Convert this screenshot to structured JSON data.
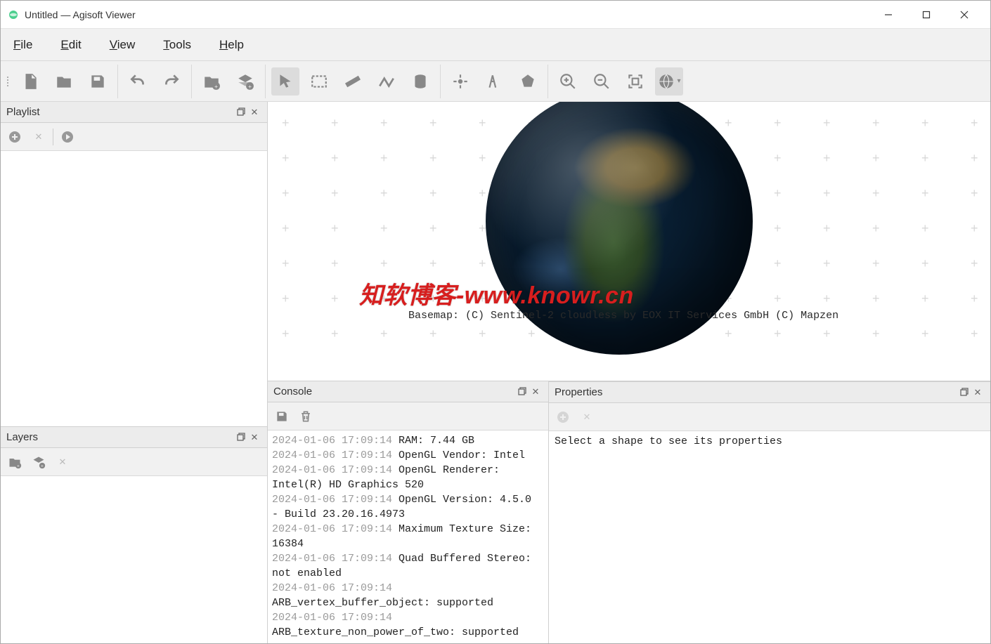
{
  "window": {
    "title": "Untitled — Agisoft Viewer",
    "minimize_label": "—",
    "maximize_label": "☐",
    "close_label": "✕"
  },
  "menubar": {
    "file": "File",
    "edit": "Edit",
    "view": "View",
    "tools": "Tools",
    "help": "Help"
  },
  "panels": {
    "playlist": {
      "title": "Playlist"
    },
    "layers": {
      "title": "Layers"
    },
    "console": {
      "title": "Console"
    },
    "properties": {
      "title": "Properties",
      "placeholder": "Select a shape to see its properties"
    }
  },
  "viewer": {
    "basemap_credits": "Basemap: (C) Sentinel-2 cloudless by EOX IT Services GmbH (C) Mapzen",
    "watermark": "知软博客-www.knowr.cn"
  },
  "console": {
    "entries": [
      {
        "ts": "2024-01-06 17:09:14",
        "msg": "RAM: 7.44 GB"
      },
      {
        "ts": "2024-01-06 17:09:14",
        "msg": "OpenGL Vendor: Intel"
      },
      {
        "ts": "2024-01-06 17:09:14",
        "msg": "OpenGL Renderer: Intel(R) HD Graphics 520"
      },
      {
        "ts": "2024-01-06 17:09:14",
        "msg": "OpenGL Version: 4.5.0 - Build 23.20.16.4973"
      },
      {
        "ts": "2024-01-06 17:09:14",
        "msg": "Maximum Texture Size: 16384"
      },
      {
        "ts": "2024-01-06 17:09:14",
        "msg": "Quad Buffered Stereo: not enabled"
      },
      {
        "ts": "2024-01-06 17:09:14",
        "msg": "ARB_vertex_buffer_object: supported"
      },
      {
        "ts": "2024-01-06 17:09:14",
        "msg": "ARB_texture_non_power_of_two: supported"
      }
    ]
  }
}
